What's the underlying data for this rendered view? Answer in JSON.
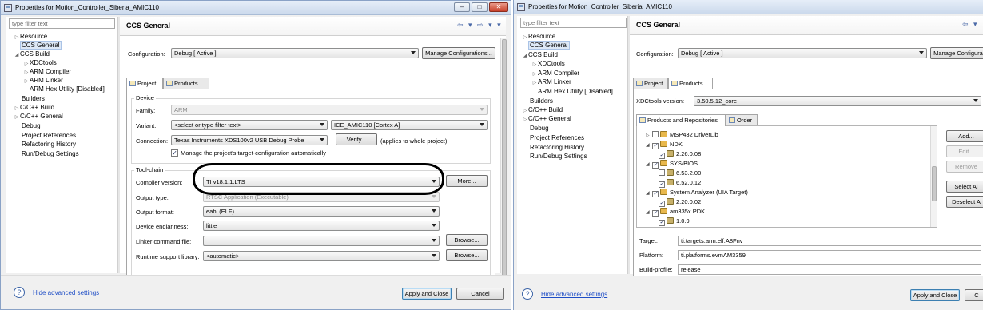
{
  "left_window": {
    "title": "Properties for Motion_Controller_Siberia_AMIC110",
    "controls": {
      "minimize": "–",
      "maximize": "□",
      "close": "✕"
    },
    "filter_placeholder": "type filter text",
    "tree": [
      "Resource",
      "CCS General",
      "CCS Build",
      "XDCtools",
      "ARM Compiler",
      "ARM Linker",
      "ARM Hex Utility  [Disabled]",
      "Builders",
      "C/C++ Build",
      "C/C++ General",
      "Debug",
      "Project References",
      "Refactoring History",
      "Run/Debug Settings"
    ],
    "page_title": "CCS General",
    "nav_arrows": "⇦ ▾ ⇨ ▾ ▾",
    "configuration_label": "Configuration:",
    "configuration_value": "Debug  [ Active ]",
    "manage_configurations": "Manage Configurations...",
    "tab_project": "Project",
    "tab_products": "Products",
    "device_group": "Device",
    "family_label": "Family:",
    "family_value": "ARM",
    "variant_label": "Variant:",
    "variant_value": "<select or type filter text>",
    "variant_device": "ICE_AMIC110 [Cortex A]",
    "connection_label": "Connection:",
    "connection_value": "Texas Instruments XDS100v2 USB Debug Probe",
    "verify_button": "Verify...",
    "applies_note": "(applies to whole project)",
    "manage_target_label": "Manage the project's target-configuration automatically",
    "toolchain_group": "Tool-chain",
    "compiler_version_label": "Compiler version:",
    "compiler_version_value": "TI v18.1.1.LTS",
    "more_button": "More...",
    "output_type_label": "Output type:",
    "output_type_value": "RTSC Application (Executable)",
    "output_format_label": "Output format:",
    "output_format_value": "eabi (ELF)",
    "endianness_label": "Device endianness:",
    "endianness_value": "little",
    "linker_cmd_label": "Linker command file:",
    "linker_cmd_value": "",
    "browse_button": "Browse...",
    "runtime_label": "Runtime support library:",
    "runtime_value": "<automatic>",
    "hide_advanced": "Hide advanced settings",
    "apply_close": "Apply and Close",
    "cancel": "Cancel",
    "help_glyph": "?"
  },
  "right_window": {
    "title": "Properties for Motion_Controller_Siberia_AMIC110",
    "filter_placeholder": "type filter text",
    "tree": [
      "Resource",
      "CCS General",
      "CCS Build",
      "XDCtools",
      "ARM Compiler",
      "ARM Linker",
      "ARM Hex Utility  [Disabled]",
      "Builders",
      "C/C++ Build",
      "C/C++ General",
      "Debug",
      "Project References",
      "Refactoring History",
      "Run/Debug Settings"
    ],
    "page_title": "CCS General",
    "nav_arrows": "⇦ ▾",
    "configuration_label": "Configuration:",
    "configuration_value": "Debug  [ Active ]",
    "manage_configurations": "Manage Configura",
    "tab_project": "Project",
    "tab_products": "Products",
    "xdctools_label": "XDCtools version:",
    "xdctools_value": "3.50.5.12_core",
    "subtab_products": "Products and Repositories",
    "subtab_order": "Order",
    "products": [
      {
        "label": "MSP432 DriverLib",
        "checked": false
      },
      {
        "label": "NDK",
        "checked": true
      },
      {
        "label": "2.26.0.08",
        "checked": true
      },
      {
        "label": "SYS/BIOS",
        "checked": true
      },
      {
        "label": "6.53.2.00",
        "checked": false
      },
      {
        "label": "6.52.0.12",
        "checked": true
      },
      {
        "label": "System Analyzer (UIA Target)",
        "checked": true
      },
      {
        "label": "2.20.0.02",
        "checked": true
      },
      {
        "label": "am335x PDK",
        "checked": true
      },
      {
        "label": "1.0.9",
        "checked": true
      }
    ],
    "add_button": "Add...",
    "edit_button": "Edit...",
    "remove_button": "Remove",
    "select_all_button": "Select Al",
    "deselect_all_button": "Deselect A",
    "target_label": "Target:",
    "target_value": "ti.targets.arm.elf.A8Fnv",
    "platform_label": "Platform:",
    "platform_value": "ti.platforms.evmAM3359",
    "build_profile_label": "Build-profile:",
    "build_profile_value": "release",
    "hide_advanced": "Hide advanced settings",
    "apply_close": "Apply and Close",
    "cancel_partial": "C",
    "help_glyph": "?"
  }
}
